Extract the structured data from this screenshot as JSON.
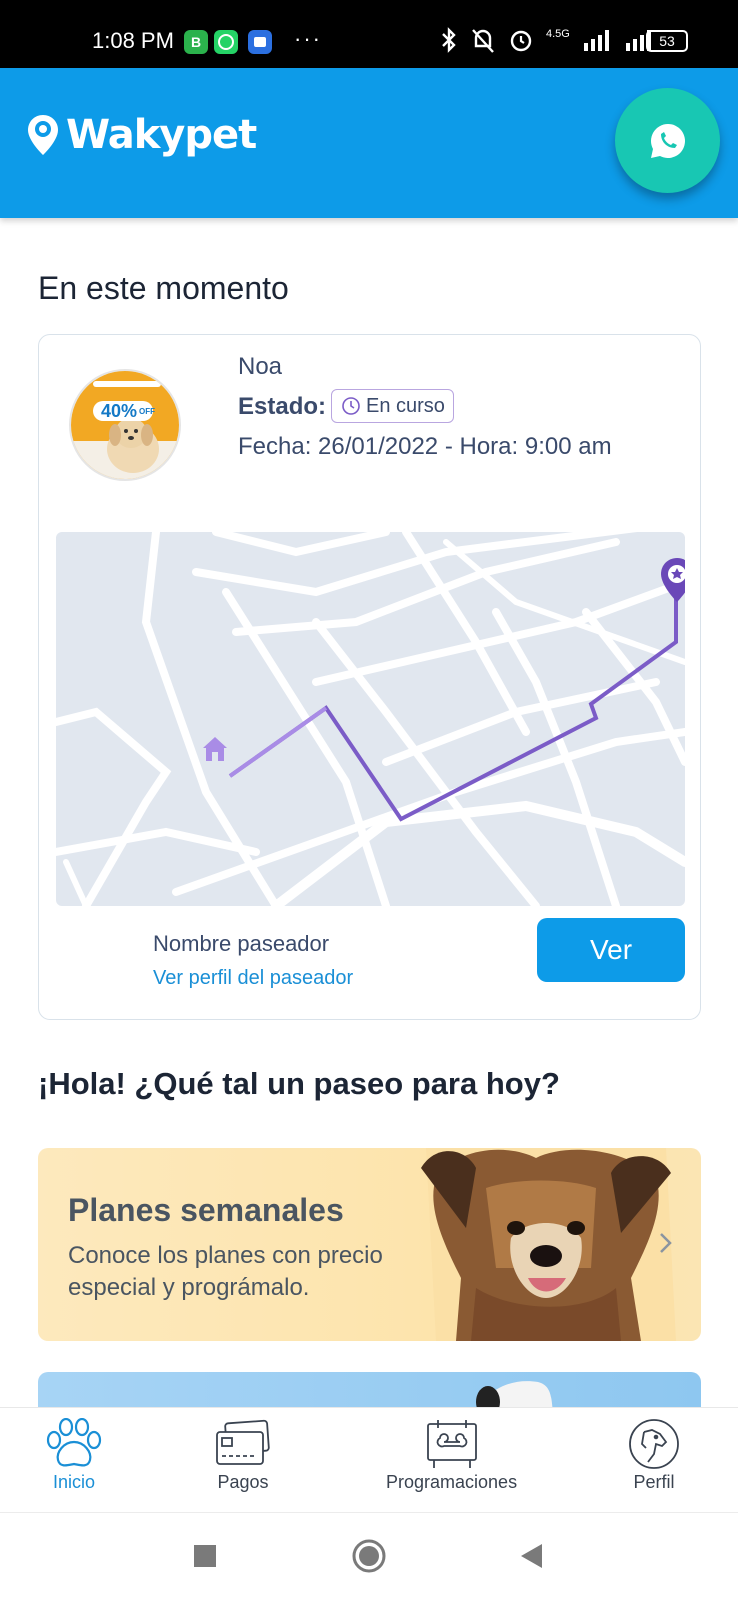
{
  "status_bar": {
    "time": "1:08 PM",
    "network": "4.5G",
    "battery": "53",
    "dots": "···"
  },
  "app_bar": {
    "logo_text": "Wakypet"
  },
  "current": {
    "section_title": "En este momento",
    "pet_name": "Noa",
    "estado_label": "Estado:",
    "status": "En curso",
    "fecha": "Fecha: 26/01/2022 - Hora: 9:00 am",
    "promo_text": "40%",
    "promo_sub": "OFF",
    "walker_name": "Nombre paseador",
    "walker_link": "Ver perfil del paseador",
    "ver_button": "Ver"
  },
  "greeting": "¡Hola! ¿Qué tal un paseo para hoy?",
  "plan_card": {
    "title": "Planes semanales",
    "description": "Conoce los planes con precio especial y prográmalo."
  },
  "bottom_nav": {
    "items": [
      {
        "label": "Inicio",
        "icon": "paw-icon",
        "active": true
      },
      {
        "label": "Pagos",
        "icon": "credit-card-icon",
        "active": false
      },
      {
        "label": "Programaciones",
        "icon": "calendar-bone-icon",
        "active": false
      },
      {
        "label": "Perfil",
        "icon": "dog-profile-icon",
        "active": false
      }
    ]
  },
  "colors": {
    "primary": "#0d9be8",
    "whatsapp": "#18c7b3",
    "route": "#7b5cc7",
    "plan_bg": "#fde4ac"
  }
}
